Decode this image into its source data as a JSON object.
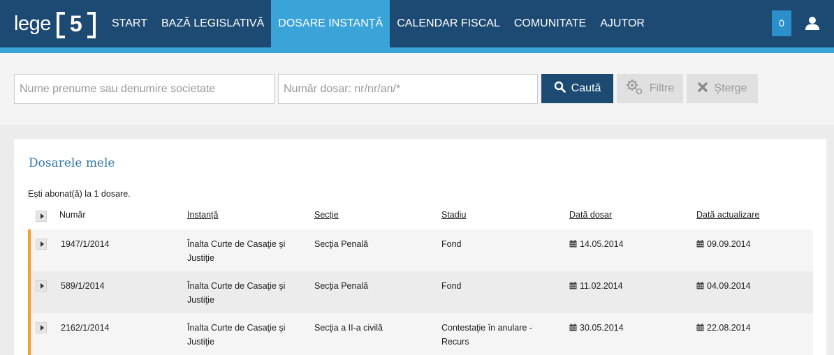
{
  "header": {
    "logo_text": "lege",
    "logo_number": "5",
    "nav": [
      {
        "label": "START",
        "active": false
      },
      {
        "label": "BAZĂ LEGISLATIVĂ",
        "active": false
      },
      {
        "label": "DOSARE INSTANȚĂ",
        "active": true
      },
      {
        "label": "CALENDAR FISCAL",
        "active": false
      },
      {
        "label": "COMUNITATE",
        "active": false
      },
      {
        "label": "AJUTOR",
        "active": false
      }
    ],
    "cart_count": "0",
    "user_icon": "user-icon"
  },
  "search": {
    "name_placeholder": "Nume prenume sau denumire societate",
    "number_placeholder": "Număr dosar: nr/nr/an/*",
    "search_label": "Caută",
    "filter_label": "Filtre",
    "clear_label": "Șterge"
  },
  "dossiers": {
    "title": "Dosarele mele",
    "subscribed_text": "Ești abonat(ă) la 1 dosare.",
    "columns": [
      "Număr",
      "Instanță",
      "Secție",
      "Stadiu",
      "Dată dosar",
      "Dată actualizare"
    ],
    "rows": [
      {
        "numar": "1947/1/2014",
        "instanta_line1": "Înalta Curte de Casaţie şi",
        "instanta_line2": "Justiţie",
        "sectie": "Secţia Penală",
        "stadiu_line1": "Fond",
        "stadiu_line2": "",
        "data_dosar": "14.05.2014",
        "data_actualizare": "09.09.2014"
      },
      {
        "numar": "589/1/2014",
        "instanta_line1": "Înalta Curte de Casaţie şi",
        "instanta_line2": "Justiţie",
        "sectie": "Secţia Penală",
        "stadiu_line1": "Fond",
        "stadiu_line2": "",
        "data_dosar": "11.02.2014",
        "data_actualizare": "04.09.2014"
      },
      {
        "numar": "2162/1/2014",
        "instanta_line1": "Înalta Curte de Casaţie şi",
        "instanta_line2": "Justiţie",
        "sectie": "Secţia a II-a civilă",
        "stadiu_line1": "Contestaţie în anulare -",
        "stadiu_line2": "Recurs",
        "data_dosar": "30.05.2014",
        "data_actualizare": "22.08.2014"
      }
    ]
  },
  "colors": {
    "header_bg": "#1d4a73",
    "accent": "#3aa3d8",
    "row_marker": "#f0a030",
    "title": "#3276a8"
  }
}
